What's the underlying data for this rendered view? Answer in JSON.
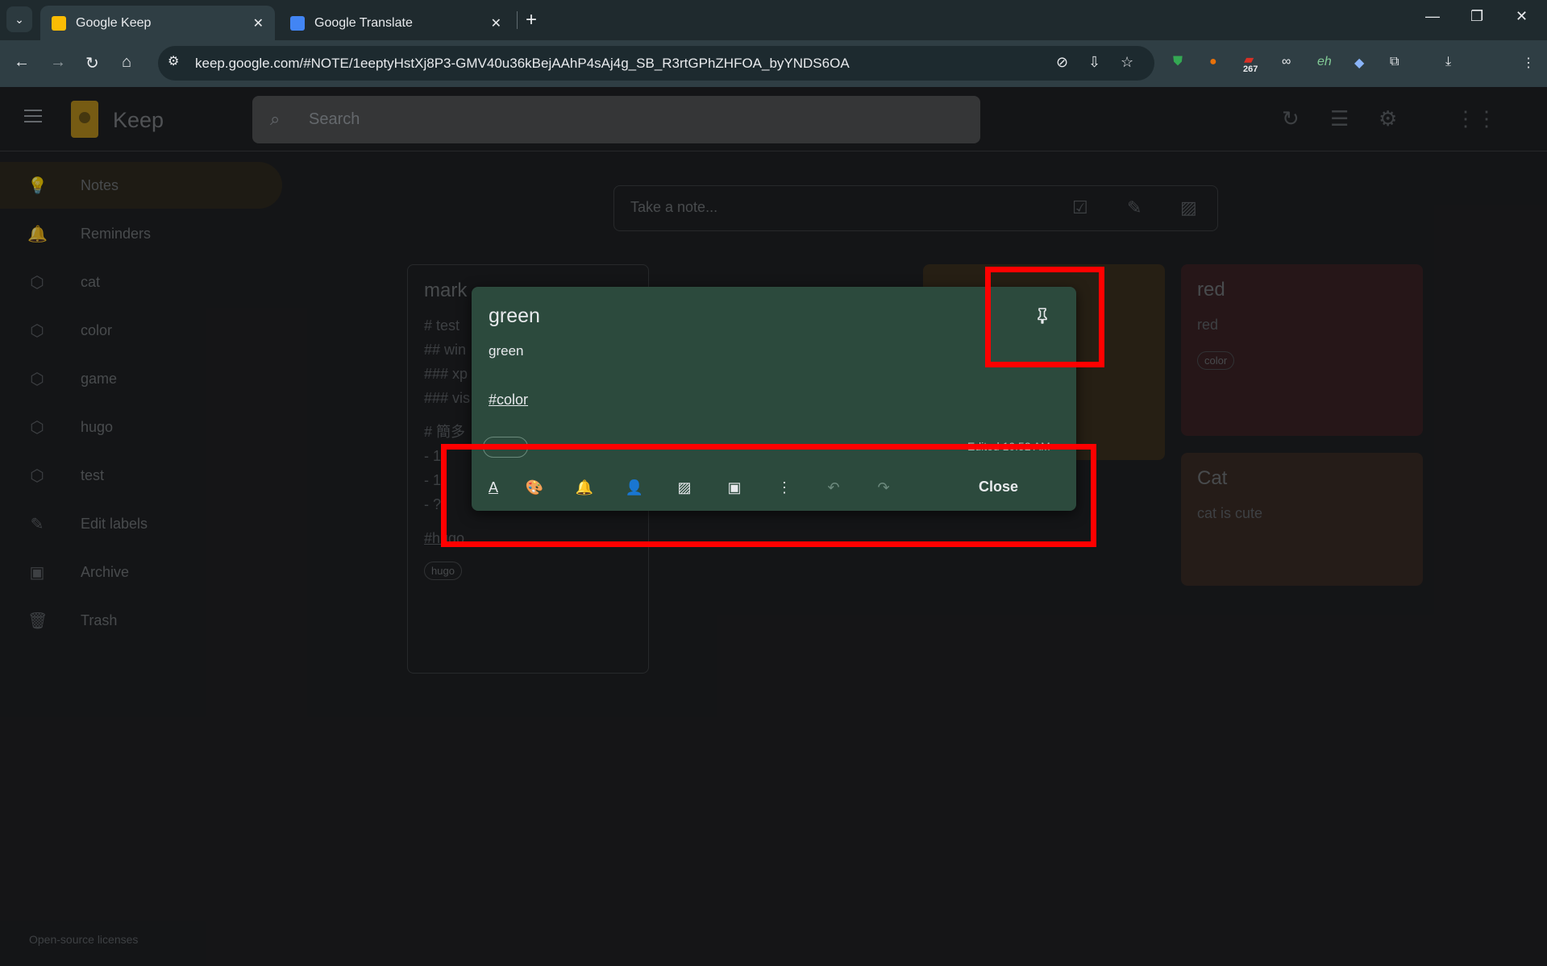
{
  "browser": {
    "tabs": [
      {
        "title": "Google Keep",
        "active": true
      },
      {
        "title": "Google Translate",
        "active": false
      }
    ],
    "url": "keep.google.com/#NOTE/1eeptyHstXj8P3-GMV40u36kBejAAhP4sAj4g_SB_R3rtGPhZHFOA_byYNDS6OA",
    "extension_badge": "267"
  },
  "keep": {
    "app_name": "Keep",
    "search_placeholder": "Search",
    "take_note_placeholder": "Take a note...",
    "sidebar": [
      {
        "label": "Notes",
        "icon": "bulb-icon",
        "active": true
      },
      {
        "label": "Reminders",
        "icon": "bell-icon"
      },
      {
        "label": "cat",
        "icon": "label-icon"
      },
      {
        "label": "color",
        "icon": "label-icon"
      },
      {
        "label": "game",
        "icon": "label-icon"
      },
      {
        "label": "hugo",
        "icon": "label-icon"
      },
      {
        "label": "test",
        "icon": "label-icon"
      },
      {
        "label": "Edit labels",
        "icon": "pencil-icon"
      },
      {
        "label": "Archive",
        "icon": "archive-icon"
      },
      {
        "label": "Trash",
        "icon": "trash-icon"
      }
    ],
    "footer_link": "Open-source licenses",
    "notes": {
      "markdown": {
        "title": "mark",
        "lines": [
          "# test",
          "## win",
          "### xp",
          "### vis",
          "",
          "# 簡多",
          "- 1",
          "- 1",
          "- ?"
        ],
        "tag": "#hugo",
        "chip": "hugo"
      },
      "red": {
        "title": "red",
        "body": "red",
        "chip": "color",
        "color": "#3b2326"
      },
      "cat": {
        "title": "Cat",
        "body": "cat is cute",
        "color": "#3a2b25"
      },
      "hidden_brown": {
        "color": "#3b3020"
      }
    },
    "modal": {
      "title": "green",
      "body": "green",
      "tag": "#color",
      "edited": "Edited 10:52 AM",
      "close_label": "Close",
      "bg_color": "#2c4a3d"
    },
    "highlight_color": "#ff0000"
  }
}
